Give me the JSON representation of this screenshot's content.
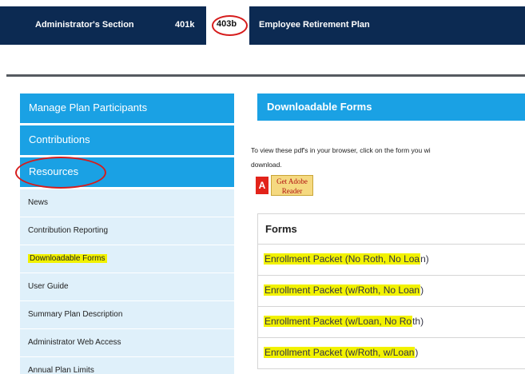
{
  "topnav": {
    "admin_section": "Administrator's Section",
    "tab_401k": "401k",
    "tab_403b": "403b",
    "plan_title": "Employee Retirement Plan"
  },
  "sidebar": {
    "main_items": [
      {
        "label": "Manage Plan Participants"
      },
      {
        "label": "Contributions"
      },
      {
        "label": "Resources"
      }
    ],
    "sub_items": [
      {
        "label": "News"
      },
      {
        "label": "Contribution Reporting"
      },
      {
        "label": "Downloadable Forms"
      },
      {
        "label": "User Guide"
      },
      {
        "label": "Summary Plan Description"
      },
      {
        "label": "Administrator Web Access"
      },
      {
        "label": "Annual Plan Limits"
      }
    ]
  },
  "content": {
    "header": "Downloadable Forms",
    "intro_line1": "To view these pdf's in your browser, click on the form you wi",
    "intro_line2": "download.",
    "adobe": {
      "logo": "A",
      "get": "Get",
      "adobe": "Adobe",
      "reader": "Reader"
    },
    "forms_heading": "Forms",
    "forms": [
      {
        "highlighted": "Enrollment Packet (No Roth, No Loa",
        "rest": "n)"
      },
      {
        "highlighted": "Enrollment Packet (w/Roth, No Loan",
        "rest": ")"
      },
      {
        "highlighted": "Enrollment Packet (w/Loan, No Ro",
        "rest": "th)"
      },
      {
        "highlighted": "Enrollment Packet (w/Roth, w/Loan",
        "rest": ")"
      }
    ]
  },
  "colors": {
    "navy": "#0c2a52",
    "accent_blue": "#1aa1e4",
    "sub_item_bg": "#dff0fa",
    "highlight": "#f2f200",
    "annotation_red": "#d61c1c"
  }
}
